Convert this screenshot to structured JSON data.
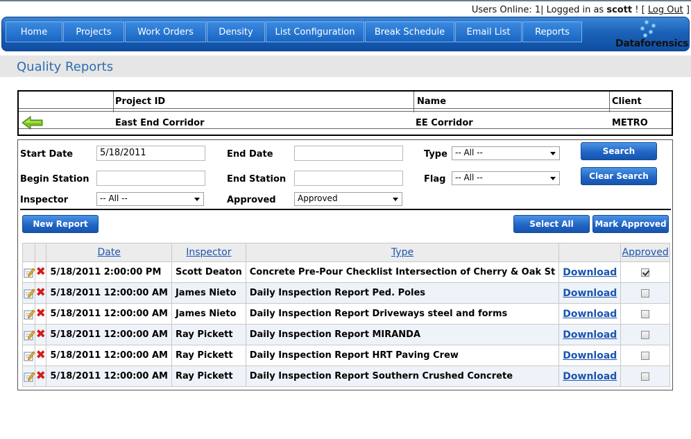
{
  "header": {
    "users_online": "Users Online: 1| Logged in as",
    "username": "scott",
    "bang_bracket": "! [",
    "logout": "Log Out",
    "close_bracket": "]"
  },
  "nav": {
    "items": [
      "Home",
      "Projects",
      "Work Orders",
      "Density",
      "List Configuration",
      "Break Schedule",
      "Email List",
      "Reports"
    ],
    "logo": "Dataforensics"
  },
  "page": {
    "title": "Quality Reports"
  },
  "project": {
    "headers": {
      "project_id": "Project ID",
      "name": "Name",
      "client": "Client"
    },
    "values": {
      "project_id": "East End Corridor",
      "name": "EE Corridor",
      "client": "METRO"
    }
  },
  "search": {
    "start_date_label": "Start Date",
    "start_date_value": "5/18/2011",
    "end_date_label": "End Date",
    "end_date_value": "",
    "type_label": "Type",
    "type_value": "-- All --",
    "begin_station_label": "Begin Station",
    "begin_station_value": "",
    "end_station_label": "End Station",
    "end_station_value": "",
    "flag_label": "Flag",
    "flag_value": "-- All --",
    "inspector_label": "Inspector",
    "inspector_value": "-- All --",
    "approved_label": "Approved",
    "approved_value": "Approved",
    "search_button": "Search",
    "clear_button": "Clear Search"
  },
  "actions": {
    "new_report": "New Report",
    "select_all": "Select All",
    "mark_approved": "Mark Approved"
  },
  "grid": {
    "columns": {
      "date": "Date",
      "inspector": "Inspector",
      "type": "Type",
      "approved": "Approved"
    },
    "download_label": "Download",
    "rows": [
      {
        "date": "5/18/2011 2:00:00 PM",
        "inspector": "Scott Deaton",
        "type": "Concrete Pre-Pour Checklist Intersection of Cherry & Oak St",
        "approved": true
      },
      {
        "date": "5/18/2011 12:00:00 AM",
        "inspector": "James Nieto",
        "type": "Daily Inspection Report Ped. Poles",
        "approved": false
      },
      {
        "date": "5/18/2011 12:00:00 AM",
        "inspector": "James Nieto",
        "type": "Daily Inspection Report Driveways steel and forms",
        "approved": false
      },
      {
        "date": "5/18/2011 12:00:00 AM",
        "inspector": "Ray Pickett",
        "type": "Daily Inspection Report MIRANDA",
        "approved": false
      },
      {
        "date": "5/18/2011 12:00:00 AM",
        "inspector": "Ray Pickett",
        "type": "Daily Inspection Report HRT Paving Crew",
        "approved": false
      },
      {
        "date": "5/18/2011 12:00:00 AM",
        "inspector": "Ray Pickett",
        "type": "Daily Inspection Report Southern Crushed Concrete",
        "approved": false
      }
    ]
  },
  "colors": {
    "nav_blue": "#1b62b8",
    "title_blue": "#2e6db0",
    "link_blue": "#1a55b0",
    "delete_red": "#d41a1a",
    "back_arrow_green": "#7bc320"
  }
}
